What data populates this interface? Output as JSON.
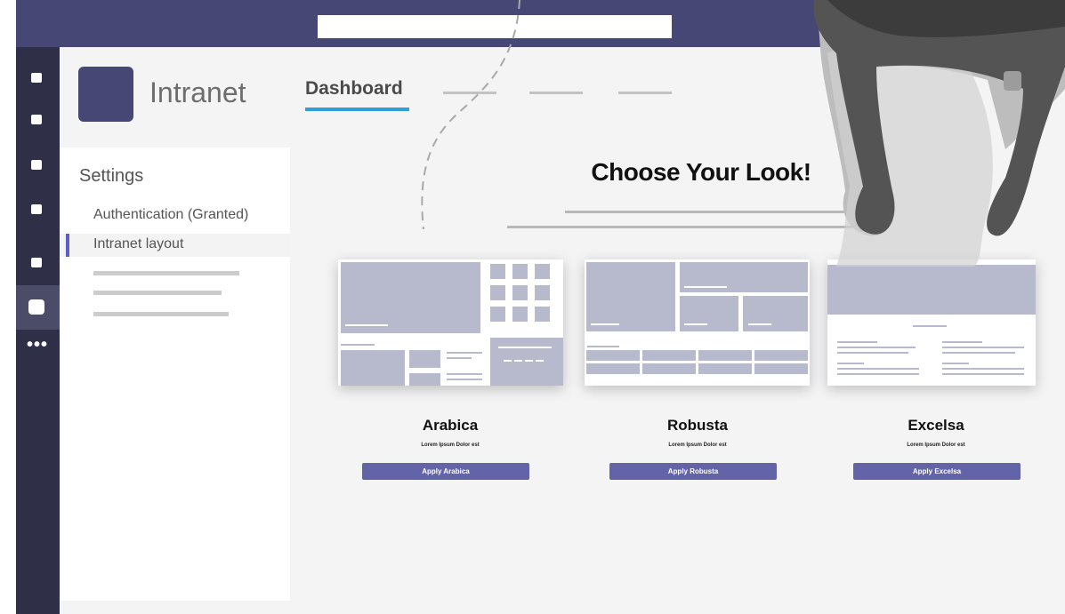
{
  "app": {
    "name": "Intranet",
    "colors": {
      "topbar": "#464775",
      "rail": "#2f2f48",
      "accent": "#6264a7",
      "tab_underline": "#2e9fd8"
    }
  },
  "search": {
    "value": ""
  },
  "rail": {
    "more_label": "•••"
  },
  "tabs": {
    "active_label": "Dashboard"
  },
  "settings": {
    "title": "Settings",
    "items": [
      {
        "label": "Authentication (Granted)"
      },
      {
        "label": "Intranet layout"
      }
    ]
  },
  "main": {
    "heading": "Choose Your Look!"
  },
  "layouts": [
    {
      "name": "Arabica",
      "subtitle": "Lorem Ipsum Dolor est",
      "button": "Apply Arabica"
    },
    {
      "name": "Robusta",
      "subtitle": "Lorem Ipsum Dolor est",
      "button": "Apply Robusta"
    },
    {
      "name": "Excelsa",
      "subtitle": "Lorem Ipsum Dolor est",
      "button": "Apply Excelsa"
    }
  ]
}
